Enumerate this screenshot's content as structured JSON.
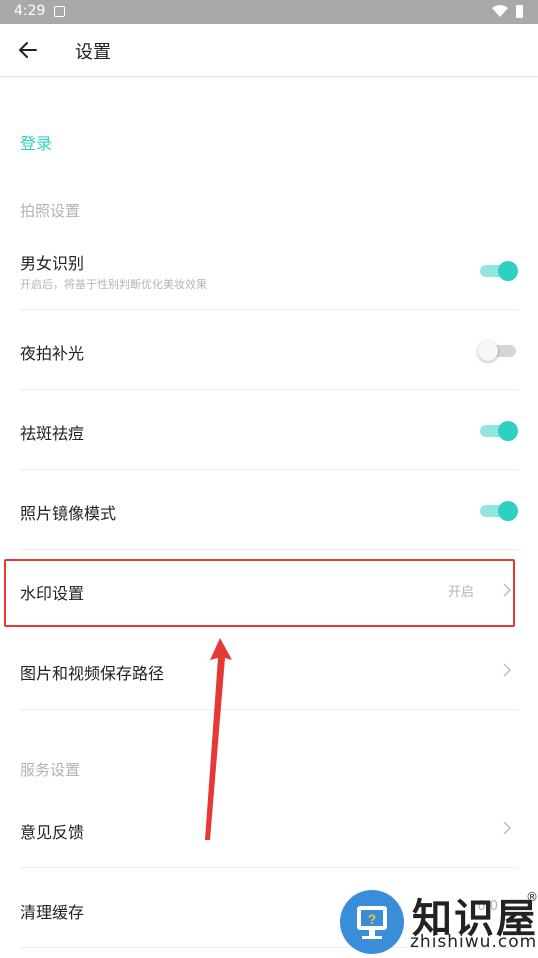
{
  "status": {
    "time": "4:29"
  },
  "header": {
    "title": "设置"
  },
  "login": {
    "label": "登录"
  },
  "sections": [
    {
      "title": "拍照设置"
    },
    {
      "title": "服务设置"
    }
  ],
  "rows": [
    {
      "label": "男女识别",
      "sub": "开启后，将基于性别判断优化美妆效果",
      "toggle": "on"
    },
    {
      "label": "夜拍补光",
      "toggle": "off"
    },
    {
      "label": "祛斑祛痘",
      "toggle": "on"
    },
    {
      "label": "照片镜像模式",
      "toggle": "on"
    },
    {
      "label": "水印设置",
      "value": "开启"
    },
    {
      "label": "图片和视频保存路径"
    },
    {
      "label": "意见反馈"
    },
    {
      "label": "清理缓存",
      "value": "0.0"
    }
  ],
  "watermark": {
    "text": "知识屋",
    "url": "zhishiwu.com",
    "reg": "®"
  },
  "colors": {
    "accent": "#2ed1c1",
    "highlight": "#e53935"
  }
}
